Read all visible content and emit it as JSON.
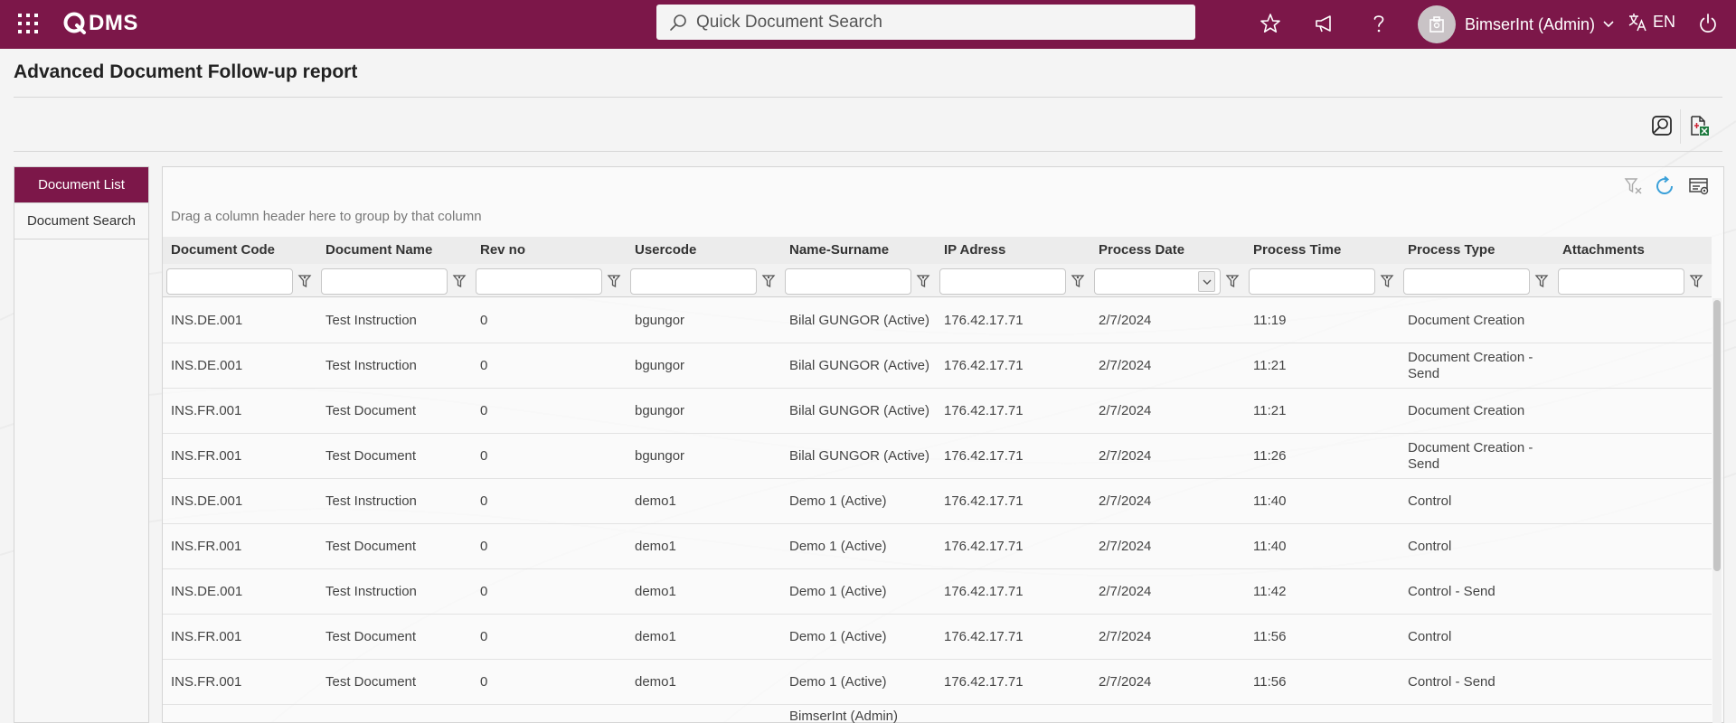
{
  "header": {
    "logo_text": "DMS",
    "search_placeholder": "Quick Document Search",
    "user_name": "BimserInt (Admin)",
    "language": "EN"
  },
  "page": {
    "title": "Advanced Document Follow-up report"
  },
  "sidebar": {
    "items": [
      {
        "label": "Document List",
        "active": true
      },
      {
        "label": "Document Search",
        "active": false
      }
    ]
  },
  "grid": {
    "group_hint": "Drag a column header here to group by that column",
    "columns": [
      "Document Code",
      "Document Name",
      "Rev no",
      "Usercode",
      "Name-Surname",
      "IP Adress",
      "Process Date",
      "Process Time",
      "Process Type",
      "Attachments"
    ],
    "rows": [
      [
        "INS.DE.001",
        "Test Instruction",
        "0",
        "bgungor",
        "Bilal GUNGOR (Active)",
        "176.42.17.71",
        "2/7/2024",
        "11:19",
        "Document Creation",
        ""
      ],
      [
        "INS.DE.001",
        "Test Instruction",
        "0",
        "bgungor",
        "Bilal GUNGOR (Active)",
        "176.42.17.71",
        "2/7/2024",
        "11:21",
        "Document Creation - Send",
        ""
      ],
      [
        "INS.FR.001",
        "Test Document",
        "0",
        "bgungor",
        "Bilal GUNGOR (Active)",
        "176.42.17.71",
        "2/7/2024",
        "11:21",
        "Document Creation",
        ""
      ],
      [
        "INS.FR.001",
        "Test Document",
        "0",
        "bgungor",
        "Bilal GUNGOR (Active)",
        "176.42.17.71",
        "2/7/2024",
        "11:26",
        "Document Creation - Send",
        ""
      ],
      [
        "INS.DE.001",
        "Test Instruction",
        "0",
        "demo1",
        "Demo 1 (Active)",
        "176.42.17.71",
        "2/7/2024",
        "11:40",
        "Control",
        ""
      ],
      [
        "INS.FR.001",
        "Test Document",
        "0",
        "demo1",
        "Demo 1 (Active)",
        "176.42.17.71",
        "2/7/2024",
        "11:40",
        "Control",
        ""
      ],
      [
        "INS.DE.001",
        "Test Instruction",
        "0",
        "demo1",
        "Demo 1 (Active)",
        "176.42.17.71",
        "2/7/2024",
        "11:42",
        "Control - Send",
        ""
      ],
      [
        "INS.FR.001",
        "Test Document",
        "0",
        "demo1",
        "Demo 1 (Active)",
        "176.42.17.71",
        "2/7/2024",
        "11:56",
        "Control",
        ""
      ],
      [
        "INS.FR.001",
        "Test Document",
        "0",
        "demo1",
        "Demo 1 (Active)",
        "176.42.17.71",
        "2/7/2024",
        "11:56",
        "Control - Send",
        ""
      ],
      [
        "",
        "",
        "",
        "",
        "BimserInt (Admin)",
        "",
        "",
        "",
        "",
        ""
      ]
    ]
  },
  "colors": {
    "brand": "#7c1749",
    "refresh_icon": "#3aa0d9"
  },
  "icons": [
    "apps-grid-icon",
    "star-icon",
    "megaphone-icon",
    "help-icon",
    "avatar-icon",
    "chevron-down-icon",
    "translate-icon",
    "power-icon",
    "report-view-icon",
    "excel-export-icon",
    "clear-filter-icon",
    "refresh-icon",
    "column-chooser-icon",
    "filter-icon"
  ]
}
